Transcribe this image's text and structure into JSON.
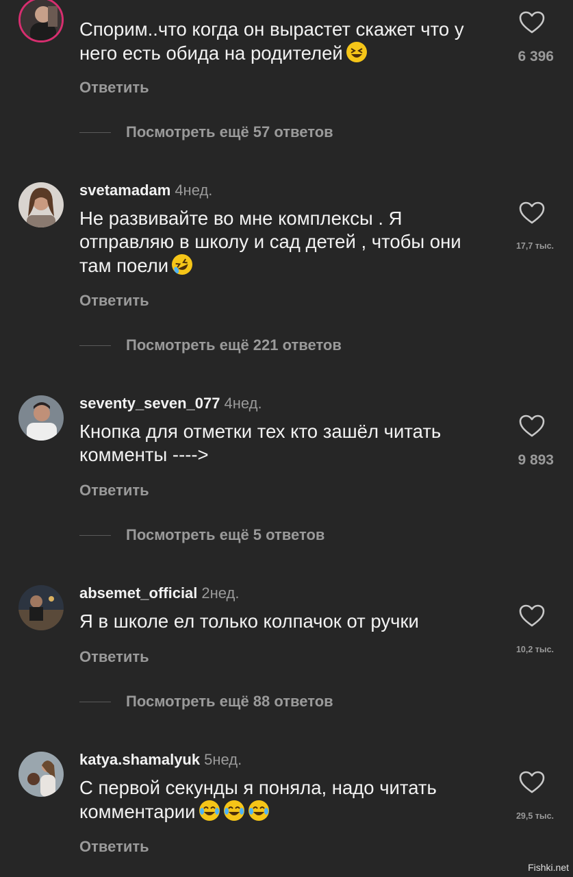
{
  "reply_label": "Ответить",
  "comments": [
    {
      "username": "",
      "age": "",
      "text": "Спорим..что когда он вырастет скажет что у него есть обида на родителей",
      "emoji": [
        "grinning-squinting-face"
      ],
      "likes": "6 396",
      "more_replies": "Посмотреть ещё 57 ответов"
    },
    {
      "username": "svetamadam",
      "age": "4нед.",
      "text": "Не развивайте во мне комплексы . Я отправляю в школу и сад детей , чтобы они там поели",
      "emoji": [
        "rolling-on-floor-laughing"
      ],
      "likes": "17,7 тыс.",
      "more_replies": "Посмотреть ещё 221 ответов"
    },
    {
      "username": "seventy_seven_077",
      "age": "4нед.",
      "text": "Кнопка для отметки тех кто зашёл читать комменты ---->",
      "emoji": [],
      "likes": "9 893",
      "more_replies": "Посмотреть ещё 5 ответов"
    },
    {
      "username": "absemet_official",
      "age": "2нед.",
      "text": "Я в школе ел только колпачок от ручки",
      "emoji": [],
      "likes": "10,2 тыс.",
      "more_replies": "Посмотреть ещё 88 ответов"
    },
    {
      "username": "katya.shamalyuk",
      "age": "5нед.",
      "text": "С первой секунды я поняла, надо читать комментарии",
      "emoji": [
        "face-with-tears-of-joy",
        "face-with-tears-of-joy",
        "face-with-tears-of-joy"
      ],
      "likes": "29,5 тыс.",
      "more_replies": ""
    }
  ],
  "watermark": "Fishki.net",
  "colors": {
    "background": "#262626",
    "text": "#f2f2f2",
    "secondary": "#9a9a9a",
    "story_ring": "#d72e6f"
  },
  "icons": [
    "heart-icon",
    "avatar"
  ]
}
